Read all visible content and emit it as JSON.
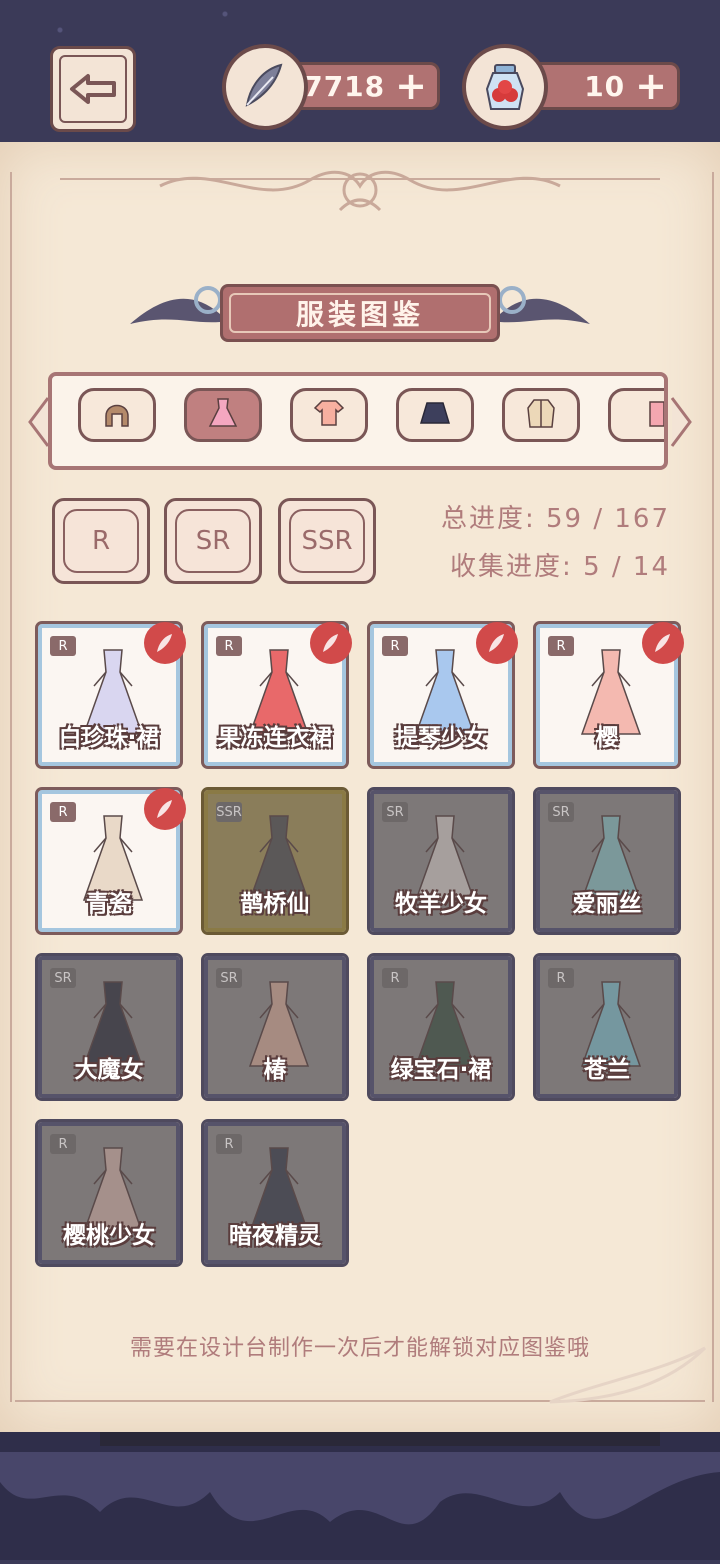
{
  "header": {
    "feather_currency": "7718",
    "jar_currency": "10",
    "plus": "+"
  },
  "title": "服装图鉴",
  "category_tabs": [
    {
      "icon": "hair-icon",
      "active": false
    },
    {
      "icon": "dress-icon",
      "active": true
    },
    {
      "icon": "top-icon",
      "active": false
    },
    {
      "icon": "skirt-icon",
      "active": false
    },
    {
      "icon": "coat-icon",
      "active": false
    },
    {
      "icon": "partial-icon",
      "active": false
    }
  ],
  "rarity_filters": [
    "R",
    "SR",
    "SSR"
  ],
  "progress": {
    "total": "总进度: 59 / 167",
    "collection": "收集进度: 5 / 14"
  },
  "items": [
    {
      "name": "白珍珠·裙",
      "rarity": "R",
      "owned": true,
      "color": "#d9d6f0"
    },
    {
      "name": "果冻连衣裙",
      "rarity": "R",
      "owned": true,
      "color": "#e8696a"
    },
    {
      "name": "提琴少女",
      "rarity": "R",
      "owned": true,
      "color": "#a9c8ee"
    },
    {
      "name": "樱",
      "rarity": "R",
      "owned": true,
      "color": "#f4b9b0"
    },
    {
      "name": "青瓷",
      "rarity": "R",
      "owned": true,
      "color": "#e9d9c8"
    },
    {
      "name": "鹊桥仙",
      "rarity": "SSR",
      "owned": false,
      "color": "#343a58"
    },
    {
      "name": "牧羊少女",
      "rarity": "SR",
      "owned": false,
      "color": "#c9c0bc"
    },
    {
      "name": "爱丽丝",
      "rarity": "SR",
      "owned": false,
      "color": "#7ab2b6"
    },
    {
      "name": "大魔女",
      "rarity": "SR",
      "owned": false,
      "color": "#1c1c2a"
    },
    {
      "name": "椿",
      "rarity": "SR",
      "owned": false,
      "color": "#c89a88"
    },
    {
      "name": "绿宝石·裙",
      "rarity": "R",
      "owned": false,
      "color": "#294032"
    },
    {
      "name": "苍兰",
      "rarity": "R",
      "owned": false,
      "color": "#6fb0c0"
    },
    {
      "name": "樱桃少女",
      "rarity": "R",
      "owned": false,
      "color": "#c7a49a"
    },
    {
      "name": "暗夜精灵",
      "rarity": "R",
      "owned": false,
      "color": "#252838"
    }
  ],
  "hint": "需要在设计台制作一次后才能解锁对应图鉴哦"
}
